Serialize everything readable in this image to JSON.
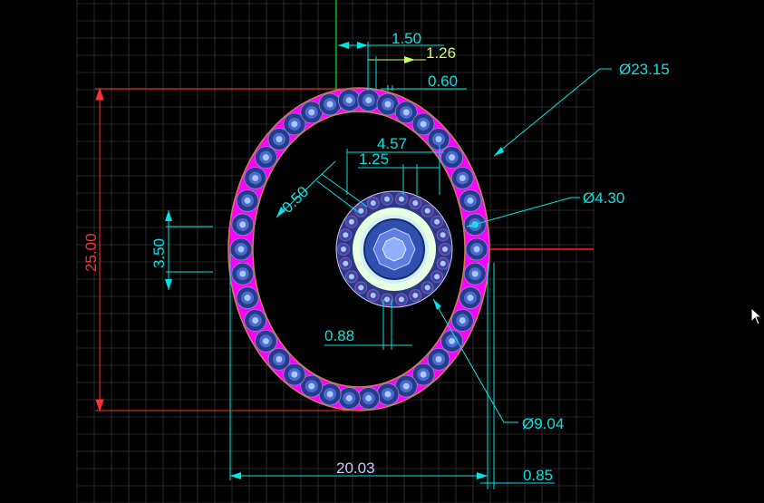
{
  "colors": {
    "background": "#000000",
    "grid": "#4a4a4a",
    "dimension": "#00e5e5",
    "dimension_alt": "#c8ff60",
    "vertical_dim": "#ff3030",
    "leader": "#00e5e5",
    "ring_fill": "#ff00ff",
    "ring_edge": "#c88050",
    "stone_outer": "#2a3a8a",
    "stone_inner": "#4a6ad0",
    "stone_core": "#a8c8ff",
    "halo_fill": "#e8ffe0",
    "center_gem": "#3050b0"
  },
  "dimensions": {
    "top_1": "1.50",
    "top_2": "1.26",
    "top_3": "0.60",
    "outer_diameter": "Ø23.15",
    "center_width": "4.57",
    "center_offset": "1.25",
    "angle_dim": "0.50",
    "halo_diameter": "Ø4.30",
    "height_small": "3.50",
    "overall_height": "25.00",
    "bottom_gap": "0.88",
    "halo_outer_diameter": "Ø9.04",
    "overall_width": "20.03",
    "edge_thickness": "0.85"
  },
  "icons": {
    "cursor": "mouse-pointer-icon"
  }
}
